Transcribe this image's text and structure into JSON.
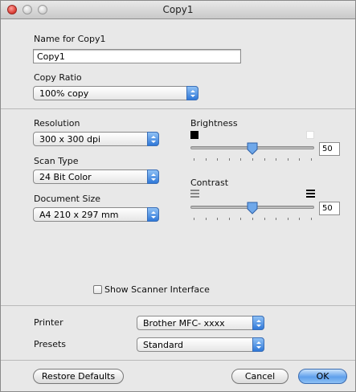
{
  "window": {
    "title": "Copy1"
  },
  "name_section": {
    "label": "Name for Copy1",
    "value": "Copy1"
  },
  "copy_ratio": {
    "label": "Copy Ratio",
    "selected": "100% copy"
  },
  "resolution": {
    "label": "Resolution",
    "selected": "300 x 300 dpi"
  },
  "scan_type": {
    "label": "Scan Type",
    "selected": "24 Bit Color"
  },
  "document_size": {
    "label": "Document Size",
    "selected": "A4  210 x 297 mm"
  },
  "brightness": {
    "label": "Brightness",
    "value": "50",
    "level": 0.5
  },
  "contrast": {
    "label": "Contrast",
    "value": "50",
    "level": 0.5
  },
  "show_scanner_interface": {
    "label": "Show Scanner Interface",
    "checked": false
  },
  "printer": {
    "label": "Printer",
    "selected": "Brother MFC- xxxx"
  },
  "presets": {
    "label": "Presets",
    "selected": "Standard"
  },
  "buttons": {
    "restore_defaults": "Restore Defaults",
    "cancel": "Cancel",
    "ok": "OK"
  },
  "colors": {
    "accent": "#3a86e6",
    "window_bg": "#e8e8e8",
    "close_button": "#d7372f"
  }
}
